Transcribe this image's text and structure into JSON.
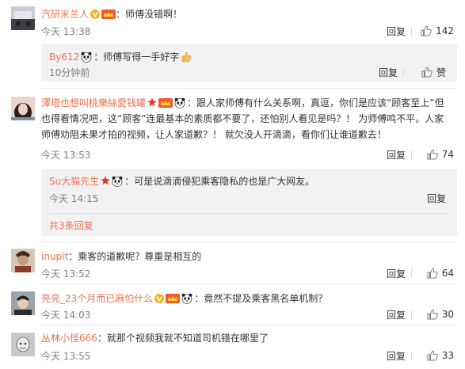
{
  "comments": [
    {
      "user": "汽研米兰人",
      "text": "：师傅没错啊！",
      "time": "今天 13:38",
      "reply_label": "回复",
      "likes": "142"
    },
    {
      "user": "澤塔也想叫桃樂絲愛钱罐",
      "text": "：跟人家师傅有什么关系啊，真逗，你们是应该“顾客至上”但也得看情况吧，这“顾客”连最基本的素质都不要了，还怕别人看见是吗？！ 为师傅鸣不平。人家师傅劝阻未果才拍的视频，让人家道歉？！ 就欠没人开滴滴，看你们让谁道歉去！",
      "time": "今天 13:53",
      "reply_label": "回复",
      "likes": "74"
    },
    {
      "user": "inupit",
      "text": "：乘客的道歉呢？尊重是相互的",
      "time": "今天 13:52",
      "reply_label": "回复",
      "likes": "64"
    },
    {
      "user": "亮亮_23个月而已麻怕什么",
      "text": "：竟然不提及乘客黑名单机制？",
      "time": "今天 14:03",
      "reply_label": "回复",
      "likes": "30"
    },
    {
      "user": "丛林小怪666",
      "text": "：就那个视频我就不知道司机错在哪里了",
      "time": "今天 13:55",
      "reply_label": "回复",
      "likes": "33"
    }
  ],
  "subreplies": [
    {
      "user": "By612",
      "text": "：师傅写得一手好字",
      "time": "10分钟前",
      "reply_label": "回复",
      "likes": "赞"
    },
    {
      "user": "Su大猫先生",
      "text": "：可是说滴滴侵犯乘客隐私的也是广大网友。",
      "time": "今天 14:15",
      "reply_label": "回复"
    }
  ],
  "more_replies": "共3条回复",
  "colors": {
    "username": "#eb7350",
    "meta": "#808080",
    "subbox_bg": "#f2f2f5"
  },
  "icons": [
    "verified-v-icon",
    "vip-crown-icon",
    "panda-emoji-icon",
    "thumbs-up-emoji-icon",
    "star-badge-icon",
    "like-icon"
  ]
}
